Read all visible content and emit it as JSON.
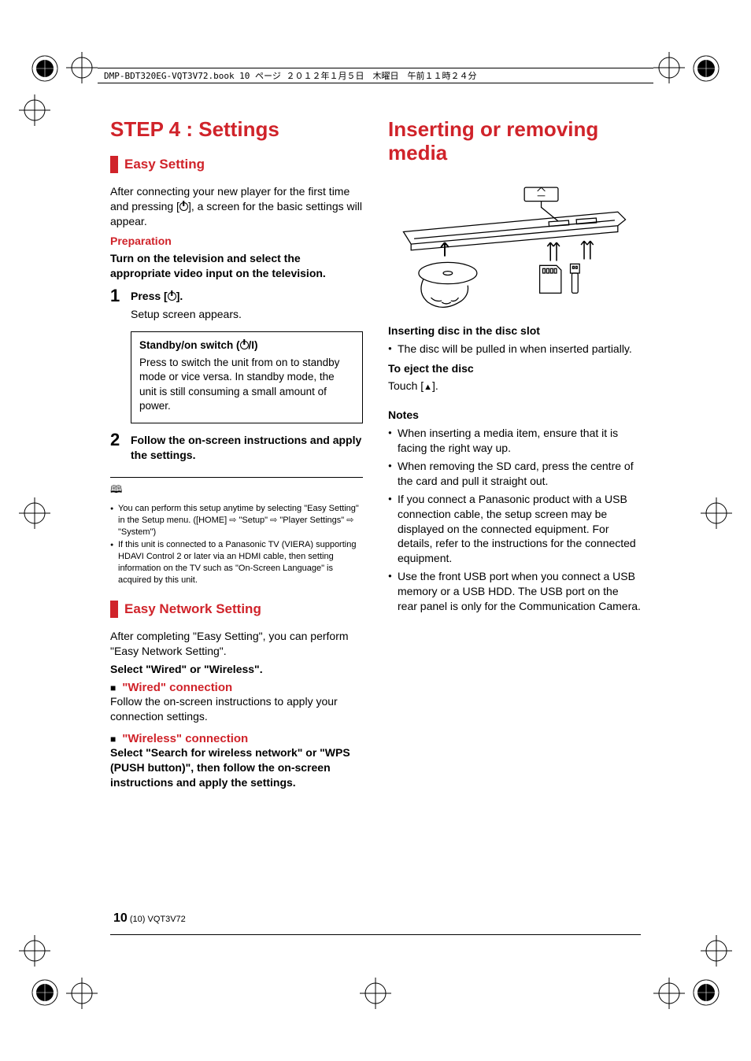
{
  "header": "DMP-BDT320EG-VQT3V72.book  10 ページ  ２０１２年１月５日　木曜日　午前１１時２４分",
  "left": {
    "h1": "STEP 4 :  Settings",
    "sec1_title": "Easy Setting",
    "intro1": "After connecting your new player for the first time and pressing [",
    "intro2": "], a screen for the basic settings will appear.",
    "prep_label": "Preparation",
    "prep_text": "Turn on the television and select the appropriate video input on the television.",
    "step1_a": "Press [",
    "step1_b": "].",
    "step1_sub": "Setup screen appears.",
    "box_title_a": "Standby/on switch (",
    "box_title_b": "/I)",
    "box_body": "Press to switch the unit from on to standby mode or vice versa. In standby mode, the unit is still consuming a small amount of power.",
    "step2": "Follow the on-screen instructions and apply the settings.",
    "small_notes": [
      "You can perform this setup anytime by selecting \"Easy Setting\" in the Setup menu. ([HOME] ⇨ \"Setup\" ⇨ \"Player Settings\" ⇨ \"System\")",
      "If this unit is connected to a Panasonic TV (VIERA) supporting HDAVI Control 2 or later via an HDMI cable, then setting information on the TV such as \"On-Screen Language\" is acquired by this unit."
    ],
    "sec2_title": "Easy Network Setting",
    "net_intro": "After completing \"Easy Setting\", you can perform \"Easy Network Setting\".",
    "net_select": "Select \"Wired\" or \"Wireless\".",
    "wired_title": "\"Wired\" connection",
    "wired_body": "Follow the on-screen instructions to apply your connection settings.",
    "wireless_title": "\"Wireless\" connection",
    "wireless_body": "Select \"Search for wireless network\" or \"WPS (PUSH button)\", then follow the on-screen instructions and apply the settings."
  },
  "right": {
    "h1": "Inserting or removing media",
    "insert_title": "Inserting disc in the disc slot",
    "insert_bullet": "The disc will be pulled in when inserted partially.",
    "eject_title": "To eject the disc",
    "eject_body_a": "Touch [",
    "eject_body_b": "].",
    "notes_title": "Notes",
    "notes": [
      "When inserting a media item, ensure that it is facing the right way up.",
      "When removing the SD card, press the centre of the card and pull it straight out.",
      "If you connect a Panasonic product with a USB connection cable, the setup screen may be displayed on the connected equipment. For details, refer to the instructions for the connected equipment.",
      "Use the front USB port when you connect a USB memory or a USB HDD. The USB port on the rear panel is only for the Communication Camera."
    ]
  },
  "footer": {
    "page": "10",
    "sub": "(10)  VQT3V72"
  }
}
